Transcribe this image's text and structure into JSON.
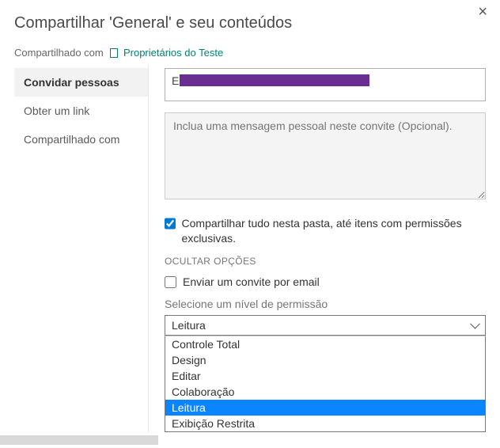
{
  "dialog": {
    "title": "Compartilhar 'General' e seu conteúdos",
    "close_label": "×"
  },
  "shared_with": {
    "label": "Compartilhado com",
    "owners_link": "Proprietários do Teste"
  },
  "sidebar": {
    "items": [
      {
        "label": "Convidar pessoas",
        "active": true
      },
      {
        "label": "Obter um link",
        "active": false
      },
      {
        "label": "Compartilhado com",
        "active": false
      }
    ]
  },
  "invite": {
    "people_prefix": "E",
    "message_placeholder": "Inclua uma mensagem pessoal neste convite (Opcional).",
    "share_all_checked": true,
    "share_all_label": "Compartilhar tudo nesta pasta, até itens com permissões exclusivas.",
    "hide_options_caption": "OCULTAR OPÇÕES",
    "send_email_checked": false,
    "send_email_label": "Enviar um convite por email",
    "permission_label": "Selecione um nível de permissão",
    "permission_selected": "Leitura",
    "permission_options": [
      "Controle Total",
      "Design",
      "Editar",
      "Colaboração",
      "Leitura",
      "Exibição Restrita"
    ]
  }
}
